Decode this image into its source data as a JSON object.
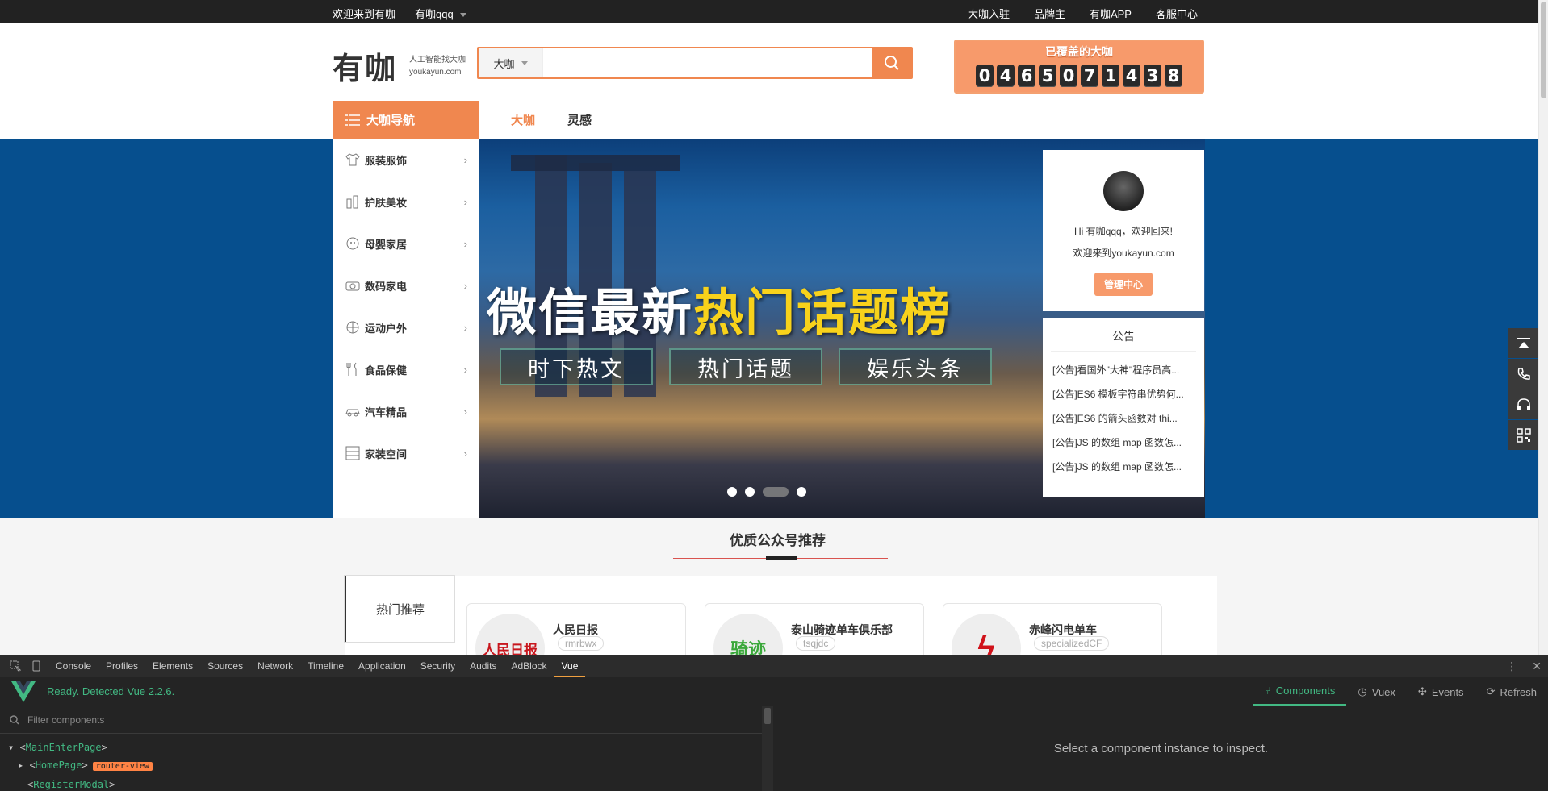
{
  "topbar": {
    "welcome": "欢迎来到有咖",
    "username": "有咖qqq",
    "links": [
      "大咖入驻",
      "品牌主",
      "有咖APP",
      "客服中心"
    ]
  },
  "header": {
    "logo_main": "有咖",
    "logo_tagline": "人工智能找大咖",
    "logo_domain": "youkayun.com",
    "search_category": "大咖",
    "search_placeholder": "",
    "counter_title": "已覆盖的大咖",
    "counter_digits": [
      "0",
      "4",
      "6",
      "5",
      "0",
      "7",
      "1",
      "4",
      "3",
      "8"
    ]
  },
  "nav": {
    "category_button": "大咖导航",
    "tabs": [
      "大咖",
      "灵感"
    ],
    "active_tab": "大咖"
  },
  "categories": [
    {
      "label": "服装服饰",
      "icon": "shirt-icon"
    },
    {
      "label": "护肤美妆",
      "icon": "cosmetics-icon"
    },
    {
      "label": "母婴家居",
      "icon": "baby-icon"
    },
    {
      "label": "数码家电",
      "icon": "camera-icon"
    },
    {
      "label": "运动户外",
      "icon": "ball-icon"
    },
    {
      "label": "食品保健",
      "icon": "cutlery-icon"
    },
    {
      "label": "汽车精品",
      "icon": "car-icon"
    },
    {
      "label": "家装空间",
      "icon": "home-icon"
    }
  ],
  "banner": {
    "headline_white": "微信最新",
    "headline_yellow": "热门话题榜",
    "pills": [
      "时下热文",
      "热门话题",
      "娱乐头条"
    ],
    "active_slide": 3,
    "slide_count": 4
  },
  "user_box": {
    "greeting": "Hi 有咖qqq，欢迎回来!",
    "welcome": "欢迎来到youkayun.com",
    "manage_button": "管理中心"
  },
  "notice": {
    "title": "公告",
    "items": [
      "[公告]看国外\"大神\"程序员高...",
      "[公告]ES6 模板字符串优势何...",
      "[公告]ES6 的箭头函数对 thi...",
      "[公告]JS 的数组 map 函数怎...",
      "[公告]JS 的数组 map 函数怎..."
    ]
  },
  "recommend": {
    "title": "优质公众号推荐",
    "tab": "热门推荐",
    "cards": [
      {
        "name": "人民日报",
        "id": "rmrbwx",
        "logo_text": "人民日报",
        "logo_color": "#c8161d"
      },
      {
        "name": "泰山骑迹单车俱乐部",
        "id": "tsqjdc",
        "logo_text": "骑迹",
        "logo_color": "#3aa83a"
      },
      {
        "name": "赤峰闪电单车",
        "id": "specializedCF",
        "logo_text": "ϟ",
        "logo_color": "#d0121a"
      }
    ]
  },
  "devtools": {
    "tabs": [
      "Console",
      "Profiles",
      "Elements",
      "Sources",
      "Network",
      "Timeline",
      "Application",
      "Security",
      "Audits",
      "AdBlock",
      "Vue"
    ],
    "active_tab": "Vue",
    "vue_status": "Ready. Detected Vue 2.2.6.",
    "vue_tabs": [
      "Components",
      "Vuex",
      "Events",
      "Refresh"
    ],
    "active_vue_tab": "Components",
    "filter_placeholder": "Filter components",
    "tree": [
      {
        "name": "MainEnterPage"
      },
      {
        "name": "HomePage",
        "badge": "router-view"
      },
      {
        "name": "RegisterModal"
      }
    ],
    "inspect_message": "Select a component instance to inspect."
  },
  "colors": {
    "accent": "#f0874f",
    "banner_blue": "#064f8e",
    "vue_green": "#42b983"
  }
}
